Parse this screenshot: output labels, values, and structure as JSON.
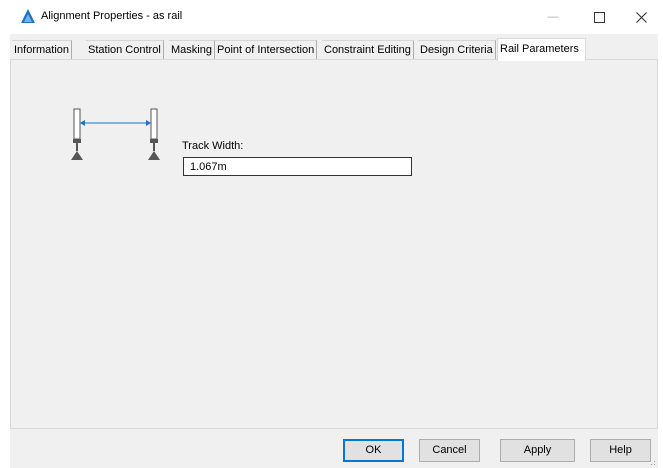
{
  "window": {
    "title": "Alignment Properties - as rail",
    "min_glyph": "—",
    "max_glyph": "☐",
    "close_glyph": "✕",
    "app_icon": "autocad-civil-icon",
    "accent_color": "#1e73be"
  },
  "tabs": [
    {
      "label": "Information"
    },
    {
      "label": "Station Control"
    },
    {
      "label": "Masking"
    },
    {
      "label": "Point of Intersection"
    },
    {
      "label": "Constraint Editing"
    },
    {
      "label": "Design Criteria"
    },
    {
      "label": "Rail Parameters",
      "active": true
    }
  ],
  "rail": {
    "track_width_label": "Track Width:",
    "track_width_value": "1.067m"
  },
  "buttons": {
    "ok": "OK",
    "cancel": "Cancel",
    "apply": "Apply",
    "help": "Help"
  }
}
